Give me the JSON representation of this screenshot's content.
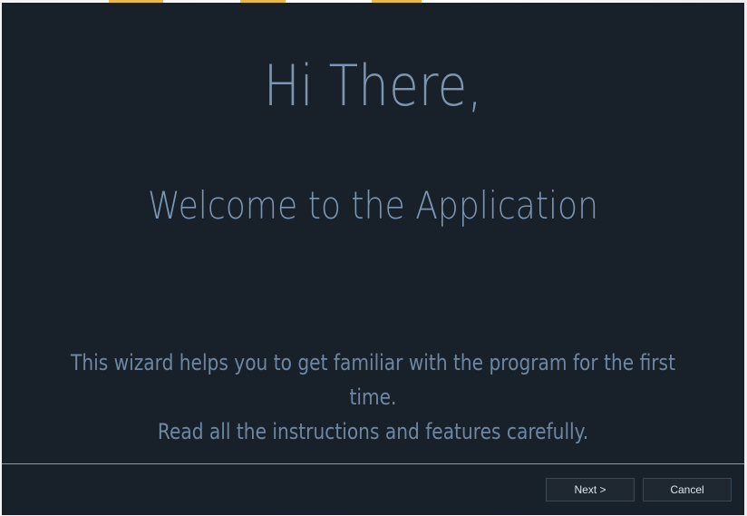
{
  "wizard": {
    "greeting": "Hi There,",
    "welcome": "Welcome to the Application",
    "description_line1": "This wizard helps you to get familiar with the program for the first time.",
    "description_line2": "Read all the instructions and features carefully."
  },
  "buttons": {
    "next_label": "Next >",
    "cancel_label": "Cancel"
  },
  "colors": {
    "background": "#18202a",
    "text_accent": "#7c95b1",
    "button_bg": "#1f2831",
    "divider": "#8c9aa8"
  }
}
